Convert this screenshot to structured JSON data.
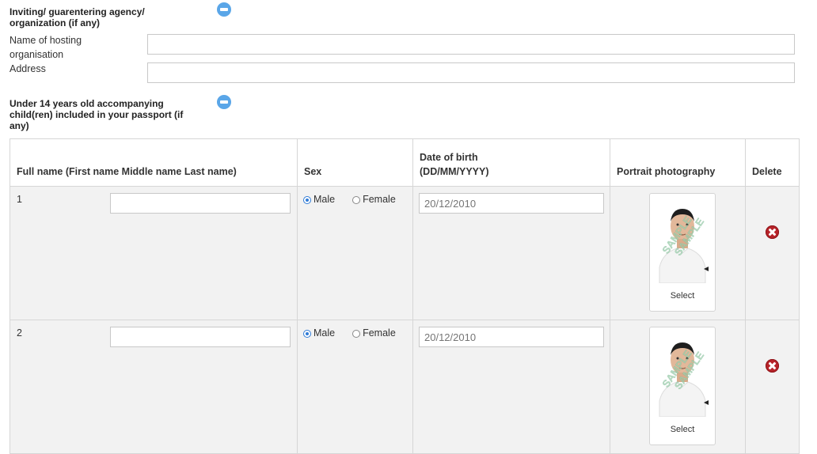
{
  "inviting": {
    "title": "Inviting/ guarentering agency/ organization (if any)",
    "fields": {
      "hosting_label": "Name of hosting organisation",
      "hosting_value": "",
      "address_label": "Address",
      "address_value": ""
    }
  },
  "children": {
    "title": "Under 14 years old accompanying child(ren) included in your passport (if any)",
    "columns": {
      "full_name": "Full name (First name Middle name Last name)",
      "sex": "Sex",
      "dob_line1": "Date of birth",
      "dob_line2": "(DD/MM/YYYY)",
      "photo": "Portrait photography",
      "delete": "Delete"
    },
    "rows": [
      {
        "number": "1",
        "name_value": "",
        "sex_male": "Male",
        "sex_female": "Female",
        "sex_selected": "Male",
        "dob_placeholder": "20/12/2010",
        "photo_label": "Select",
        "photo_watermark": "SAMPLE"
      },
      {
        "number": "2",
        "name_value": "",
        "sex_male": "Male",
        "sex_female": "Female",
        "sex_selected": "Male",
        "dob_placeholder": "20/12/2010",
        "photo_label": "Select",
        "photo_watermark": "SAMPLE"
      }
    ]
  },
  "colors": {
    "collapse_button": "#5aa6e8",
    "delete_button": "#b7242a",
    "radio_selected": "#2f7bd6"
  },
  "icons": {
    "collapse": "minus-circle-icon",
    "delete": "close-circle-icon",
    "photo": "portrait-sample-icon"
  }
}
